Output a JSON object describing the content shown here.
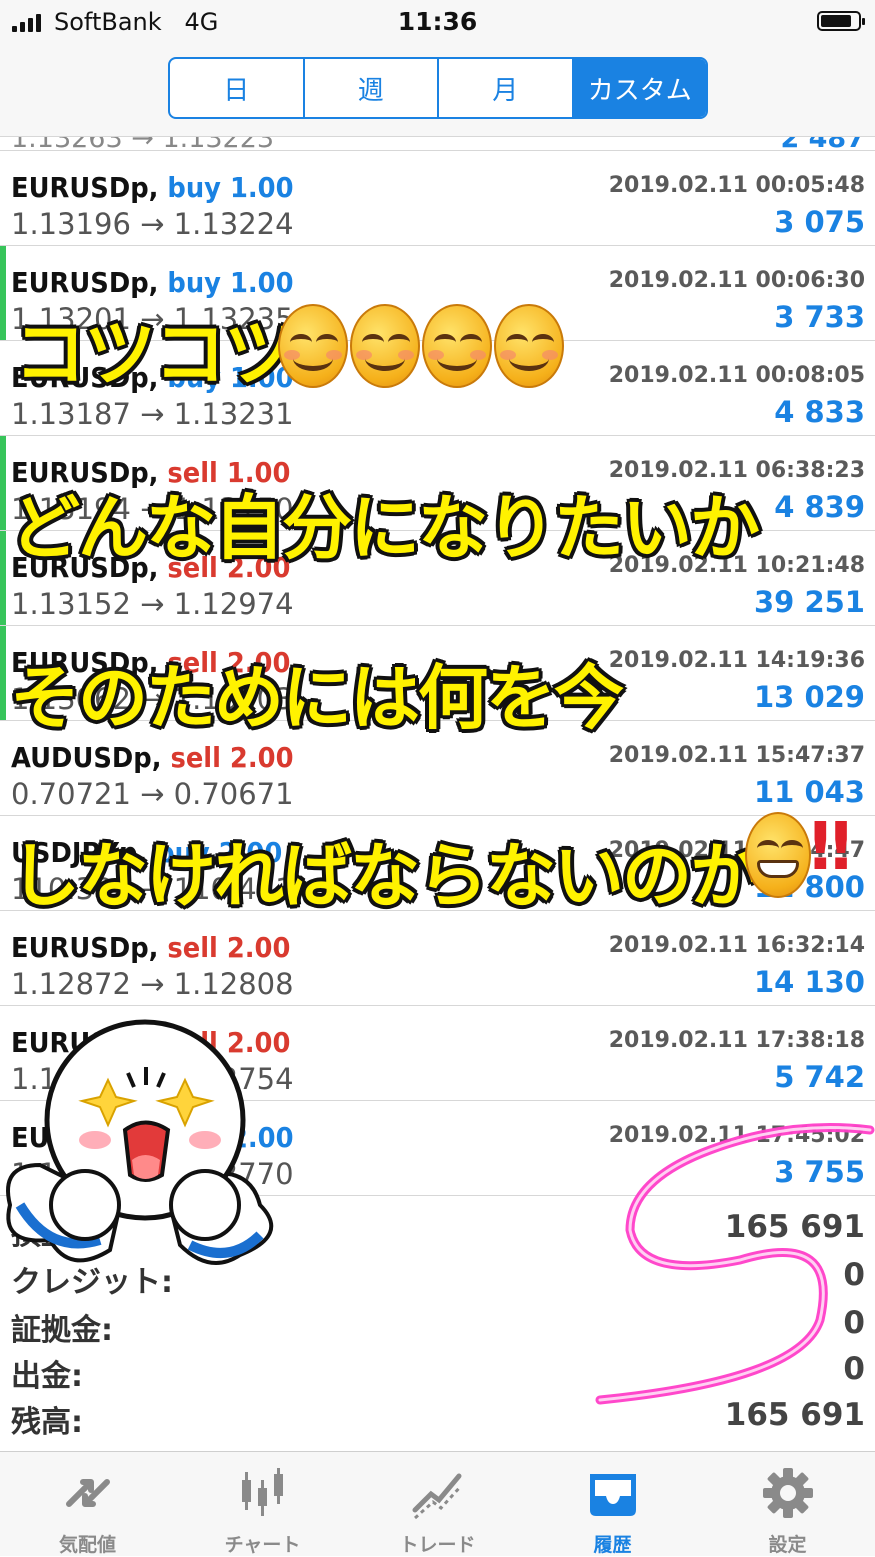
{
  "status_bar": {
    "carrier": "SoftBank",
    "network": "4G",
    "time": "11:36"
  },
  "header": {
    "segments": [
      {
        "label": "日",
        "active": false
      },
      {
        "label": "週",
        "active": false
      },
      {
        "label": "月",
        "active": false
      },
      {
        "label": "カスタム",
        "active": true
      }
    ]
  },
  "history": {
    "partial_row": {
      "prices": "1.13263 → 1.13223",
      "profit": "2 487"
    },
    "rows": [
      {
        "symbol": "EURUSDp,",
        "direction": "buy 1.00",
        "type": "buy",
        "datetime": "2019.02.11 00:05:48",
        "prices": "1.13196 → 1.13224",
        "profit": "3 075",
        "marked": false
      },
      {
        "symbol": "EURUSDp,",
        "direction": "buy 1.00",
        "type": "buy",
        "datetime": "2019.02.11 00:06:30",
        "prices": "1.13201 → 1.13235",
        "profit": "3 733",
        "marked": true
      },
      {
        "symbol": "EURUSDp,",
        "direction": "buy 1.00",
        "type": "buy",
        "datetime": "2019.02.11 00:08:05",
        "prices": "1.13187 → 1.13231",
        "profit": "4 833",
        "marked": false
      },
      {
        "symbol": "EURUSDp,",
        "direction": "sell 1.00",
        "type": "sell",
        "datetime": "2019.02.11 06:38:23",
        "prices": "1.13194 → 1.13150",
        "profit": "4 839",
        "marked": true
      },
      {
        "symbol": "EURUSDp,",
        "direction": "sell 2.00",
        "type": "sell",
        "datetime": "2019.02.11 10:21:48",
        "prices": "1.13152 → 1.12974",
        "profit": "39 251",
        "marked": true
      },
      {
        "symbol": "EURUSDp,",
        "direction": "sell 2.00",
        "type": "sell",
        "datetime": "2019.02.11 14:19:36",
        "prices": "1.13062 → 1.13003",
        "profit": "13 029",
        "marked": true
      },
      {
        "symbol": "AUDUSDp,",
        "direction": "sell 2.00",
        "type": "sell",
        "datetime": "2019.02.11 15:47:37",
        "prices": "0.70721 → 0.70671",
        "profit": "11 043",
        "marked": false
      },
      {
        "symbol": "USDJPYp,",
        "direction": "buy 2.00",
        "type": "buy",
        "datetime": "2019.02.11 16:04:47",
        "prices": "110.382 → 110.441",
        "profit": "11 800",
        "marked": false
      },
      {
        "symbol": "EURUSDp,",
        "direction": "sell 2.00",
        "type": "sell",
        "datetime": "2019.02.11 16:32:14",
        "prices": "1.12872 → 1.12808",
        "profit": "14 130",
        "marked": false
      },
      {
        "symbol": "EURUSDp,",
        "direction": "sell 2.00",
        "type": "sell",
        "datetime": "2019.02.11 17:38:18",
        "prices": "1.12789 → 1.12754",
        "profit": "5 742",
        "marked": false
      },
      {
        "symbol": "EURUSDp,",
        "direction": "buy 2.00",
        "type": "buy",
        "datetime": "2019.02.11 17:45:02",
        "prices": "1.12751 → 1.12770",
        "profit": "3 755",
        "marked": false
      }
    ]
  },
  "summary": [
    {
      "label": "損益:",
      "value": "165 691"
    },
    {
      "label": "クレジット:",
      "value": "0"
    },
    {
      "label": "証拠金:",
      "value": "0"
    },
    {
      "label": "出金:",
      "value": "0"
    },
    {
      "label": "残高:",
      "value": "165 691"
    }
  ],
  "tabbar": {
    "tabs": [
      {
        "label": "気配値",
        "icon": "quotes-arrows-icon",
        "active": false
      },
      {
        "label": "チャート",
        "icon": "candlestick-icon",
        "active": false
      },
      {
        "label": "トレード",
        "icon": "trade-trend-icon",
        "active": false
      },
      {
        "label": "履歴",
        "icon": "history-inbox-icon",
        "active": true
      },
      {
        "label": "設定",
        "icon": "gear-icon",
        "active": false
      }
    ]
  },
  "overlay": {
    "line1": "コツコツ",
    "line2": "どんな自分になりたいか",
    "line3": "そのためには何を今",
    "line4": "しなければならないのか",
    "exclaim": "‼",
    "colors": {
      "text": "#fff200",
      "outline": "#111111",
      "circle": "#ff3ec8",
      "accent": "#1a82e2",
      "buy": "#1a82e2",
      "sell": "#d93a2f",
      "marker": "#37c45a"
    }
  }
}
